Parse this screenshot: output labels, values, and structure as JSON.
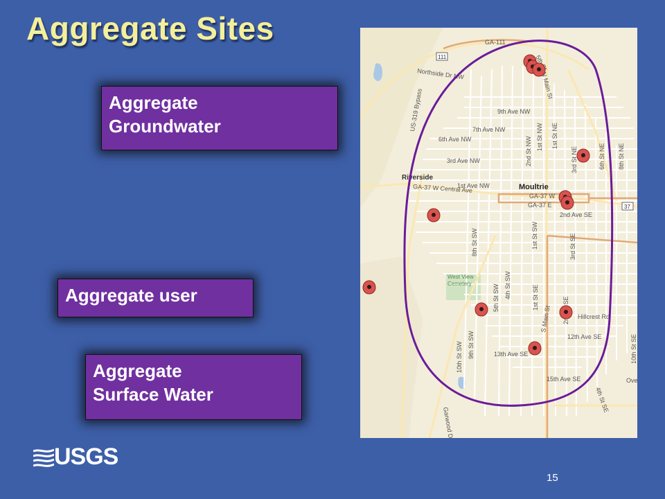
{
  "slide": {
    "title": "Aggregate Sites",
    "page_number": "15",
    "logo_text": "USGS"
  },
  "legend_boxes": [
    {
      "line1": "Aggregate",
      "line2": "Groundwater"
    },
    {
      "line1": "Aggregate user"
    },
    {
      "line1": "Aggregate",
      "line2": "Surface Water"
    }
  ],
  "map": {
    "city_label": "Moultrie",
    "place_label": "Riverside",
    "cemetery_label_1": "West View",
    "cemetery_label_2": "Cemetery",
    "shield_111": "111",
    "shield_37": "37",
    "streets": {
      "ga111": "GA-111",
      "northside": "Northside Dr NW",
      "fifth_st": "5th St",
      "main_st": "N Main St",
      "ave9": "9th Ave NW",
      "ave7": "7th Ave NW",
      "ave6": "6th Ave NW",
      "ave3": "3rd Ave NW",
      "ave1": "1st Ave NW",
      "ga37w_central": "GA-37 W Central Ave",
      "ga37w": "GA-37 W",
      "ga37e": "GA-37 E",
      "ave2se": "2nd Ave SE",
      "st2nw": "2nd St NW",
      "st1nw": "1st St NW",
      "st1ne": "1st St NE",
      "st3ne": "3rd St NE",
      "st6ne": "6th St NE",
      "st8ne": "8th St NE",
      "st8sw": "8th St SW",
      "st1sw": "1st St SW",
      "st3se": "3rd St SE",
      "st5sw": "5th St SW",
      "st4sw": "4th St SW",
      "st1se": "1st St SE",
      "st2se": "2nd St SE",
      "smain": "S Main St",
      "hillcrest": "Hillcrest Rd",
      "ave12": "12th Ave SE",
      "ave13": "13th Ave SE",
      "ave15": "15th Ave SE",
      "st10sw": "10th St SW",
      "st9sw": "9th St SW",
      "st4se": "4th St SE",
      "st10se": "10th St SE",
      "bypass": "US-319 Bypass",
      "ove": "Ove",
      "garwood": "Garwood Dr"
    }
  },
  "colors": {
    "background": "#3d5fa8",
    "title": "#f4ef9a",
    "box_fill": "#7030a0",
    "boundary_outline": "#6a1b9a",
    "marker": "#d9534f"
  }
}
